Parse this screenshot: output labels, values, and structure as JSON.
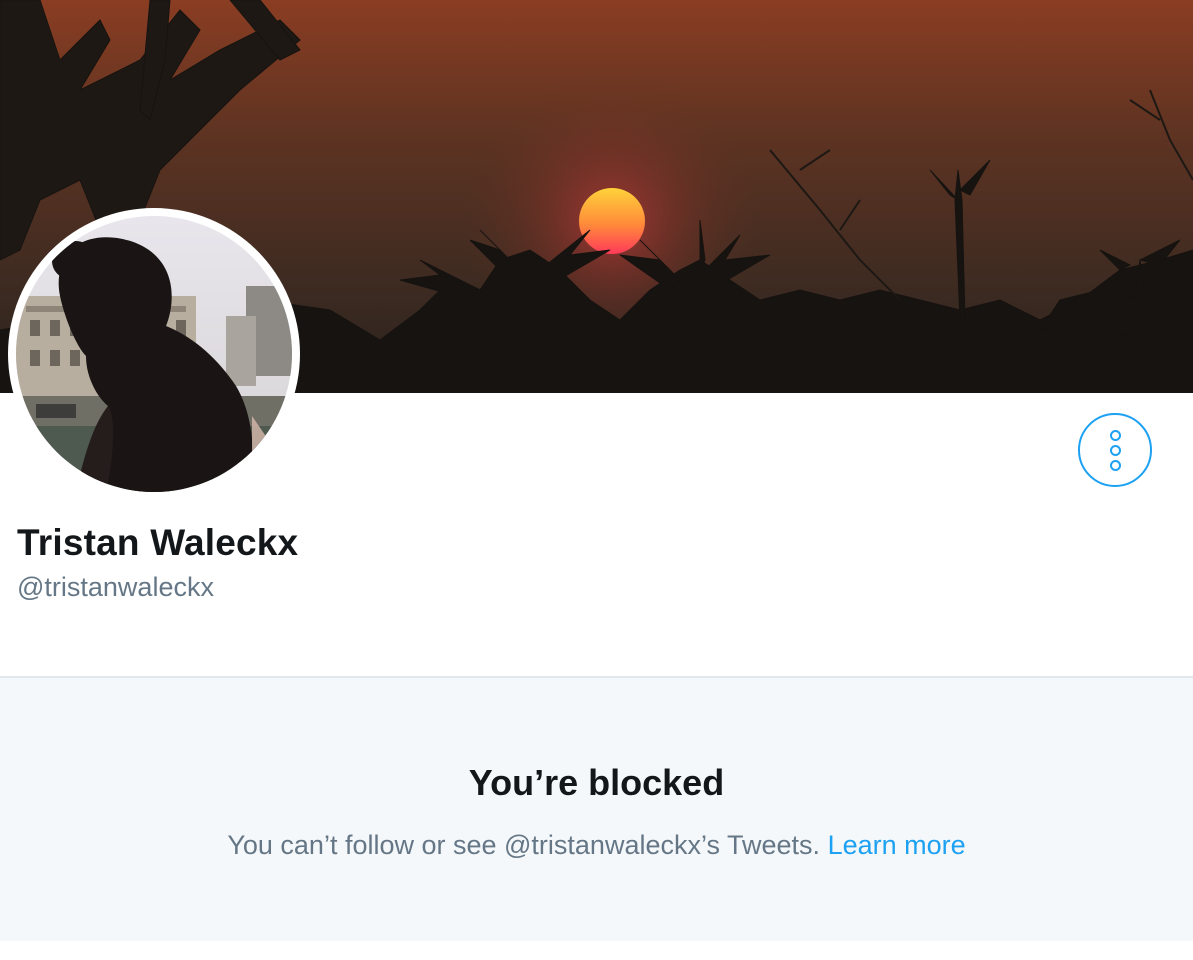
{
  "profile": {
    "display_name": "Tristan Waleckx",
    "handle": "@tristanwaleckx"
  },
  "header_image": {
    "description_icon": "sunset-banner-image"
  },
  "avatar": {
    "icon": "profile-photo-avatar"
  },
  "more_button": {
    "icon": "more-vertical-icon"
  },
  "blocked": {
    "title": "You’re blocked",
    "message": "You can’t follow or see @tristanwaleckx’s Tweets.",
    "learn_more": "Learn more"
  },
  "colors": {
    "accent": "#1da1f2",
    "text_primary": "#14171a",
    "text_secondary": "#657786",
    "blocked_bg": "#f5f8fa",
    "divider": "#e1e8ed"
  }
}
